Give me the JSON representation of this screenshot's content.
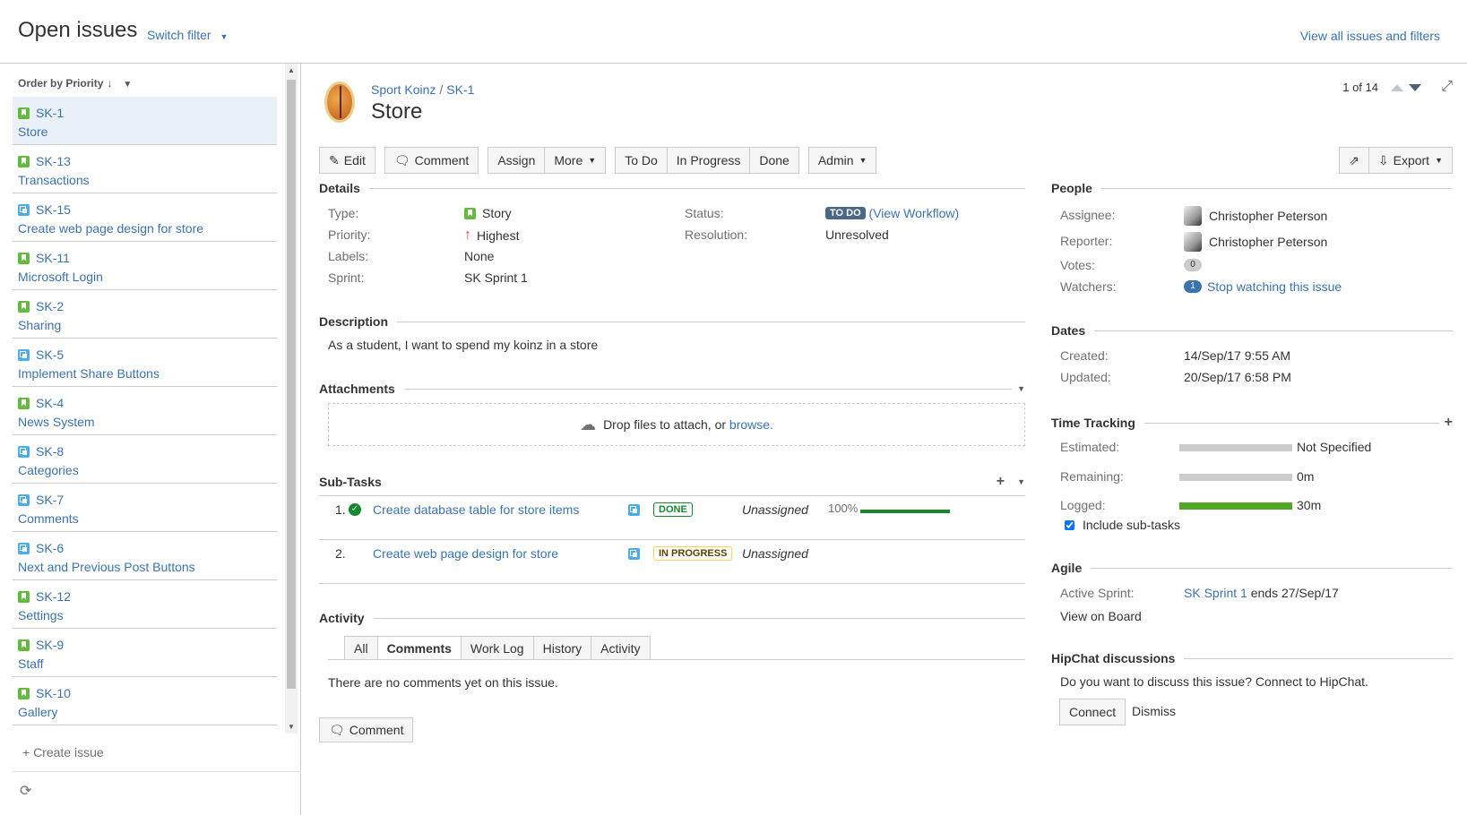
{
  "header": {
    "title": "Open issues",
    "switch_filter": "Switch filter",
    "view_all": "View all issues and filters"
  },
  "left": {
    "order_by": "Order by Priority",
    "create_issue": "+ Create issue",
    "issues": [
      {
        "key": "SK-1",
        "summary": "Store",
        "type": "story"
      },
      {
        "key": "SK-13",
        "summary": "Transactions",
        "type": "story"
      },
      {
        "key": "SK-15",
        "summary": "Create web page design for store",
        "type": "subtask"
      },
      {
        "key": "SK-11",
        "summary": "Microsoft Login",
        "type": "story"
      },
      {
        "key": "SK-2",
        "summary": "Sharing",
        "type": "story"
      },
      {
        "key": "SK-5",
        "summary": "Implement Share Buttons",
        "type": "subtask"
      },
      {
        "key": "SK-4",
        "summary": "News System",
        "type": "story"
      },
      {
        "key": "SK-8",
        "summary": "Categories",
        "type": "subtask"
      },
      {
        "key": "SK-7",
        "summary": "Comments",
        "type": "subtask"
      },
      {
        "key": "SK-6",
        "summary": "Next and Previous Post Buttons",
        "type": "subtask"
      },
      {
        "key": "SK-12",
        "summary": "Settings",
        "type": "story"
      },
      {
        "key": "SK-9",
        "summary": "Staff",
        "type": "story"
      },
      {
        "key": "SK-10",
        "summary": "Gallery",
        "type": "story"
      }
    ]
  },
  "issue": {
    "project": "Sport Koinz",
    "key": "SK-1",
    "title": "Store",
    "pager": "1 of 14"
  },
  "toolbar": {
    "edit": "Edit",
    "comment": "Comment",
    "assign": "Assign",
    "more": "More",
    "todo": "To Do",
    "in_progress": "In Progress",
    "done": "Done",
    "admin": "Admin",
    "export": "Export"
  },
  "details": {
    "heading": "Details",
    "type_label": "Type:",
    "type_value": "Story",
    "priority_label": "Priority:",
    "priority_value": "Highest",
    "labels_label": "Labels:",
    "labels_value": "None",
    "sprint_label": "Sprint:",
    "sprint_value": "SK Sprint 1",
    "status_label": "Status:",
    "status_value": "TO DO",
    "view_workflow": "(View Workflow)",
    "resolution_label": "Resolution:",
    "resolution_value": "Unresolved"
  },
  "description": {
    "heading": "Description",
    "text": "As a student, I want to spend my koinz in a store"
  },
  "attachments": {
    "heading": "Attachments",
    "drop_text": "Drop files to attach, or",
    "browse": "browse."
  },
  "subtasks": {
    "heading": "Sub-Tasks",
    "items": [
      {
        "num": "1.",
        "summary": "Create database table for store items",
        "status": "DONE",
        "assignee": "Unassigned",
        "progress": "100%"
      },
      {
        "num": "2.",
        "summary": "Create web page design for store",
        "status": "IN PROGRESS",
        "assignee": "Unassigned"
      }
    ]
  },
  "activity": {
    "heading": "Activity",
    "tabs": [
      "All",
      "Comments",
      "Work Log",
      "History",
      "Activity"
    ],
    "empty": "There are no comments yet on this issue.",
    "comment_button": "Comment"
  },
  "people": {
    "heading": "People",
    "assignee_label": "Assignee:",
    "assignee": "Christopher Peterson",
    "reporter_label": "Reporter:",
    "reporter": "Christopher Peterson",
    "votes_label": "Votes:",
    "votes": "0",
    "watchers_label": "Watchers:",
    "watchers_count": "1",
    "watch_link": "Stop watching this issue"
  },
  "dates": {
    "heading": "Dates",
    "created_label": "Created:",
    "created": "14/Sep/17 9:55 AM",
    "updated_label": "Updated:",
    "updated": "20/Sep/17 6:58 PM"
  },
  "time_tracking": {
    "heading": "Time Tracking",
    "estimated_label": "Estimated:",
    "estimated": "Not Specified",
    "estimated_fill": 0,
    "remaining_label": "Remaining:",
    "remaining": "0m",
    "remaining_fill": 0,
    "logged_label": "Logged:",
    "logged": "30m",
    "logged_fill": 1,
    "include_subtasks": "Include sub-tasks"
  },
  "agile": {
    "heading": "Agile",
    "active_sprint_label": "Active Sprint:",
    "sprint_link": "SK Sprint 1",
    "sprint_ends": "ends 27/Sep/17",
    "view_on_board": "View on Board"
  },
  "hipchat": {
    "heading": "HipChat discussions",
    "text": "Do you want to discuss this issue? Connect to HipChat.",
    "connect": "Connect",
    "dismiss": "Dismiss"
  }
}
